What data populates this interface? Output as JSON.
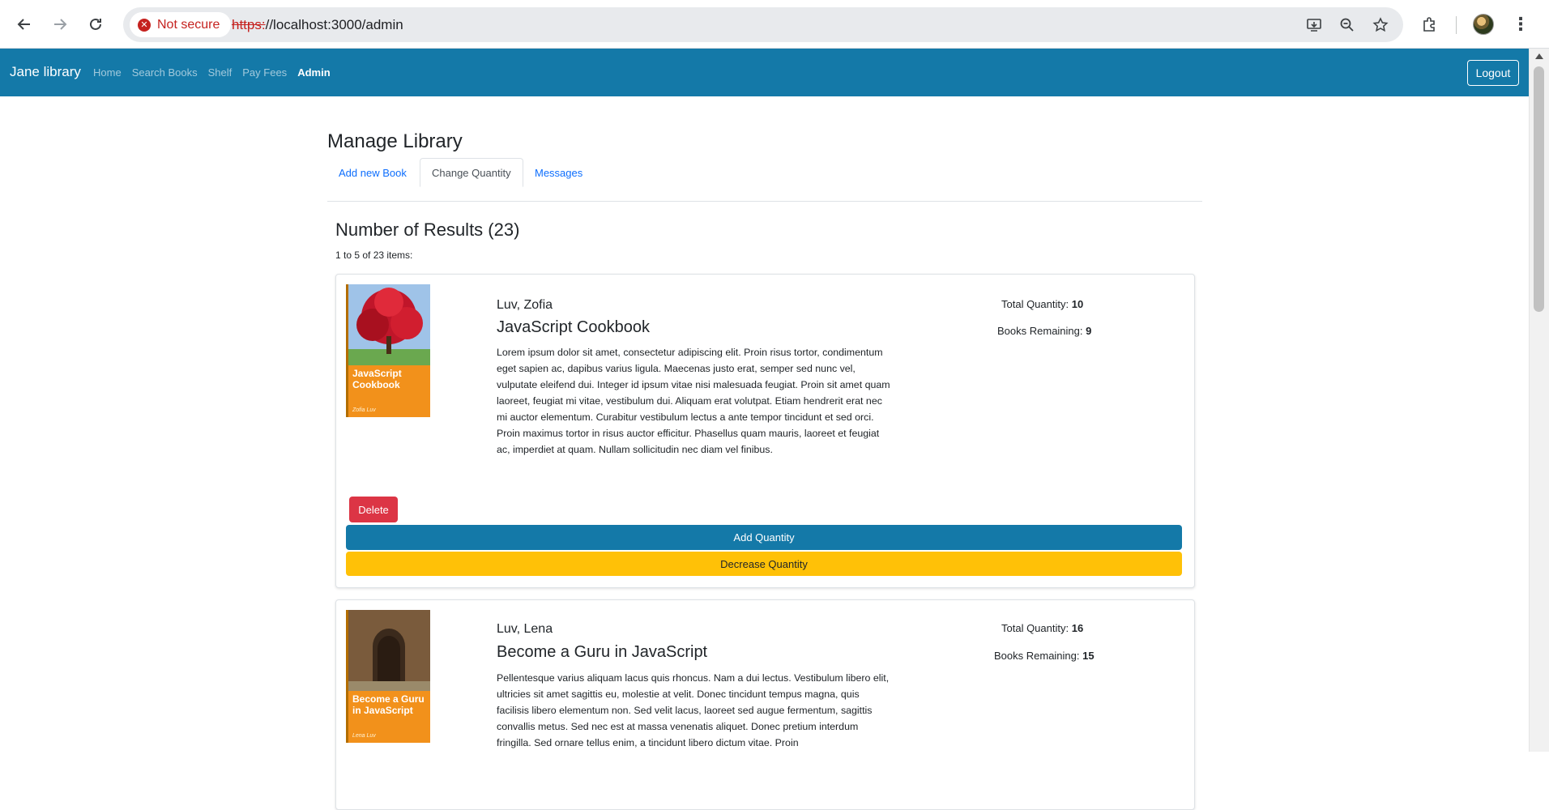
{
  "browser": {
    "security_label": "Not secure",
    "url_scheme": "https:",
    "url_rest": "//localhost:3000/admin",
    "icons": [
      "back-icon",
      "forward-icon",
      "reload-icon",
      "install-icon",
      "zoom-icon",
      "bookmark-star-icon",
      "extensions-icon",
      "profile-avatar",
      "menu-kebab-icon"
    ]
  },
  "navbar": {
    "brand": "Jane library",
    "links": [
      {
        "label": "Home",
        "active": false
      },
      {
        "label": "Search Books",
        "active": false
      },
      {
        "label": "Shelf",
        "active": false
      },
      {
        "label": "Pay Fees",
        "active": false
      },
      {
        "label": "Admin",
        "active": true
      }
    ],
    "logout_label": "Logout",
    "bg_color": "#1479a8"
  },
  "page": {
    "title": "Manage Library",
    "tabs": [
      {
        "label": "Add new Book",
        "active": false
      },
      {
        "label": "Change Quantity",
        "active": true
      },
      {
        "label": "Messages",
        "active": false
      }
    ],
    "results_title": "Number of Results (23)",
    "results_sub": "1 to 5 of 23 items:"
  },
  "books": [
    {
      "author": "Luv, Zofia",
      "title": "JavaScript Cookbook",
      "cover_title": "JavaScript Cookbook",
      "cover_author": "Zofia Luv",
      "description": "Lorem ipsum dolor sit amet, consectetur adipiscing elit. Proin risus tortor, condimentum eget sapien ac, dapibus varius ligula. Maecenas justo erat, semper sed nunc vel, vulputate eleifend dui. Integer id ipsum vitae nisi malesuada feugiat. Proin sit amet quam laoreet, feugiat mi vitae, vestibulum dui. Aliquam erat volutpat. Etiam hendrerit erat nec mi auctor elementum. Curabitur vestibulum lectus a ante tempor tincidunt et sed orci. Proin maximus tortor in risus auctor efficitur. Phasellus quam mauris, laoreet et feugiat ac, imperdiet at quam. Nullam sollicitudin nec diam vel finibus.",
      "total_label": "Total Quantity: ",
      "total_value": "10",
      "remaining_label": "Books Remaining: ",
      "remaining_value": "9",
      "delete_label": "Delete",
      "add_label": "Add Quantity",
      "decrease_label": "Decrease Quantity"
    },
    {
      "author": "Luv, Lena",
      "title": "Become a Guru in JavaScript",
      "cover_title": "Become a Guru in JavaScript",
      "cover_author": "Lena Luv",
      "description": "Pellentesque varius aliquam lacus quis rhoncus. Nam a dui lectus. Vestibulum libero elit, ultricies sit amet sagittis eu, molestie at velit. Donec tincidunt tempus magna, quis facilisis libero elementum non. Sed velit lacus, laoreet sed augue fermentum, sagittis convallis metus. Sed nec est at massa venenatis aliquet. Donec pretium interdum fringilla. Sed ornare tellus enim, a tincidunt libero dictum vitae. Proin",
      "total_label": "Total Quantity: ",
      "total_value": "16",
      "remaining_label": "Books Remaining: ",
      "remaining_value": "15"
    }
  ]
}
